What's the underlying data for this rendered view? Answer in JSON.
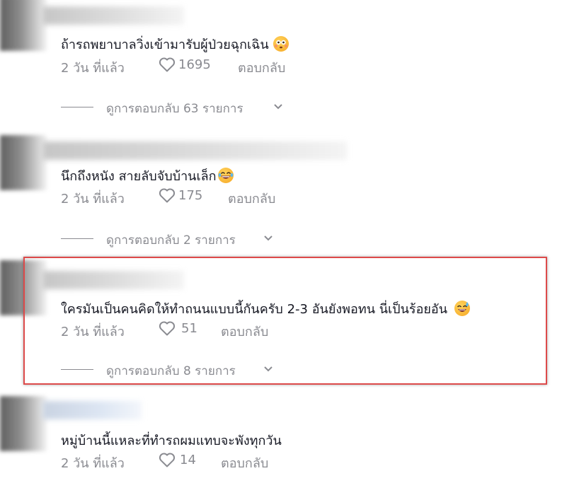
{
  "comments": [
    {
      "text": "ถ้ารถพยาบาลวิ่งเข้ามารับผู้ป่วยฉุกเฉิน",
      "time": "2 วัน ที่แล้ว",
      "likes": "1695",
      "reply_label": "ตอบกลับ",
      "view_replies": "ดูการตอบกลับ 63 รายการ",
      "emoji": "flushed-face-emoji"
    },
    {
      "text": "นึกถึงหนัง สายลับจับบ้านเล็ก",
      "time": "2 วัน ที่แล้ว",
      "likes": "175",
      "reply_label": "ตอบกลับ",
      "view_replies": "ดูการตอบกลับ 2 รายการ",
      "emoji": "laughing-face-emoji"
    },
    {
      "text": "ใครมันเป็นคนคิดให้ทำถนนแบบนี้กันครับ 2-3 อันยังพอทน นี่เป็นร้อยอัน",
      "time": "2 วัน ที่แล้ว",
      "likes": "51",
      "reply_label": "ตอบกลับ",
      "view_replies": "ดูการตอบกลับ 8 รายการ",
      "emoji": "sweat-smile-emoji"
    },
    {
      "text": "หมู่บ้านนี้แหละที่ทำรถผมแทบจะพังทุกวัน",
      "time": "2 วัน ที่แล้ว",
      "likes": "14",
      "reply_label": "ตอบกลับ"
    }
  ],
  "colors": {
    "highlight": "#dd4a4a",
    "text": "#161823",
    "muted": "#8a8b91"
  },
  "icons": {
    "like": "heart-outline-icon",
    "expand": "chevron-down-icon"
  }
}
